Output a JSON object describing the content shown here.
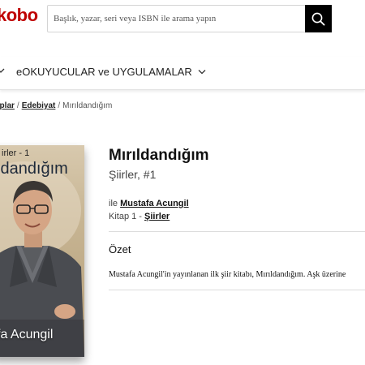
{
  "header": {
    "logo_text": "kobo",
    "search": {
      "placeholder": "Başlık, yazar, seri veya ISBN ile arama yapın"
    },
    "search_icon": "search-icon"
  },
  "nav": {
    "items": [
      {
        "label": "eOKUYUCULAR ve UYGULAMALAR",
        "icon": "chevron-down-icon"
      }
    ]
  },
  "breadcrumb": {
    "items": [
      "aplar",
      "Edebiyat"
    ],
    "current": "Mırıldandığım",
    "separator": "/"
  },
  "book": {
    "cover": {
      "series_text": "irler - 1",
      "title_text": "ldandığım",
      "author_text": "fa Acungil"
    },
    "title": "Mırıldandığım",
    "subtitle": "Şiirler, #1",
    "author_prefix": "ile",
    "author": "Mustafa Acungil",
    "series_prefix": "Kitap 1 -",
    "series": "Şiirler",
    "summary_heading": "Özet",
    "summary_text": "Mustafa Acungil'in yayınlanan ilk şiir kitabı, Mırıldandığım. Aşk üzerine"
  },
  "colors": {
    "brand": "#bf0000",
    "search_button": "#000000"
  }
}
